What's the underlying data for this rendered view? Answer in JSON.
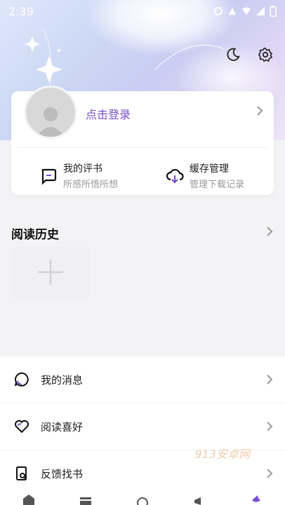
{
  "status": {
    "time": "2:39"
  },
  "header": {
    "dark_mode_icon": "moon-icon",
    "settings_icon": "gear-icon"
  },
  "user_card": {
    "login_label": "点击登录",
    "quick_actions": [
      {
        "title": "我的评书",
        "subtitle": "所感所悟所想",
        "icon": "comment-icon"
      },
      {
        "title": "缓存管理",
        "subtitle": "管理下载记录",
        "icon": "cloud-download-icon"
      }
    ]
  },
  "history": {
    "title": "阅读历史"
  },
  "menu": [
    {
      "label": "我的消息",
      "icon": "message-icon"
    },
    {
      "label": "阅读喜好",
      "icon": "heart-icon"
    },
    {
      "label": "反馈找书",
      "icon": "search-book-icon"
    }
  ],
  "watermark": "913安卓网",
  "colors": {
    "accent": "#7a4fd0"
  }
}
